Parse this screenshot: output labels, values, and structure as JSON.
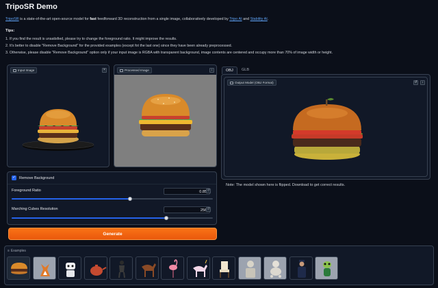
{
  "app": {
    "title": "TripoSR Demo",
    "desc_link": "TripoSR",
    "desc_text1": " is a state-of-the-art open-source model for ",
    "desc_bold": "fast",
    "desc_text2": " feedforward 3D reconstruction from a single image, collaboratively developed by ",
    "desc_link2": "Tripo AI",
    "desc_and": " and ",
    "desc_link3": "Stability AI",
    "desc_end": "."
  },
  "tips": {
    "title": "Tips:",
    "items": [
      "1. If you find the result is unsatisfied, please try to change the foreground ratio. It might improve the results.",
      "2. It's better to disable \"Remove Background\" for the provided examples (except fot the last one) since they have been already preprocessed.",
      "3. Otherwise, please disable \"Remove Background\" option only if your input image is RGBA with transparent background, image contents are centered and occupy more than 70% of image width or height."
    ]
  },
  "input_image": {
    "label": "Input Image"
  },
  "processed_image": {
    "label": "Processed Image"
  },
  "controls": {
    "remove_bg_label": "Remove Background",
    "remove_bg_checked": true,
    "fg_ratio_label": "Foreground Ratio",
    "fg_ratio_value": "0.85",
    "fg_ratio_fraction": 0.59,
    "mc_res_label": "Marching Cubes Resolution",
    "mc_res_value": "256",
    "mc_res_fraction": 0.77,
    "generate_label": "Generate"
  },
  "output": {
    "tabs": [
      "OBJ",
      "GLB"
    ],
    "active_tab": "OBJ",
    "model_label": "Output Model (OBJ Format)",
    "note": "Note: The model shown here is flipped. Download to get correct results."
  },
  "examples": {
    "label": "Examples",
    "items": [
      "hamburger",
      "fox",
      "robot",
      "teapot",
      "figure",
      "horse",
      "flamingo",
      "unicorn",
      "chair",
      "statue",
      "poodle",
      "police",
      "alien"
    ]
  },
  "colors": {
    "accent": "#f97316",
    "slider": "#2563eb",
    "bg": "#0b0f19"
  }
}
